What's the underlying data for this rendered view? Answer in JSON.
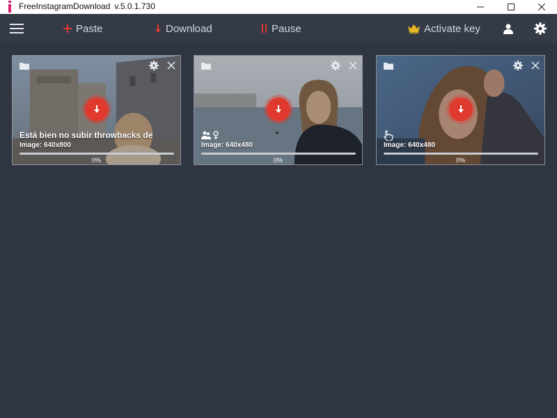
{
  "window": {
    "app_name": "FreeInstagramDownload",
    "version": "v.5.0.1.730"
  },
  "toolbar": {
    "paste_label": "Paste",
    "download_label": "Download",
    "pause_label": "Pause",
    "activate_label": "Activate key"
  },
  "colors": {
    "accent": "#e03a2f",
    "gold": "#e8b923",
    "toolbar_bg": "#343b47",
    "content_bg": "#2f3541"
  },
  "cards": [
    {
      "caption": "Está bien no subir throwbacks de",
      "meta": "Image: 640x800",
      "progress_percent": 0,
      "progress_label": "0%"
    },
    {
      "caption": "",
      "meta": "Image: 640x480",
      "progress_percent": 0,
      "progress_label": "0%",
      "icons": [
        "people-icon",
        "female-icon"
      ]
    },
    {
      "caption": "",
      "meta": "Image: 640x480",
      "progress_percent": 0,
      "progress_label": "0%",
      "icons": [
        "hand-pointer-icon"
      ]
    }
  ]
}
